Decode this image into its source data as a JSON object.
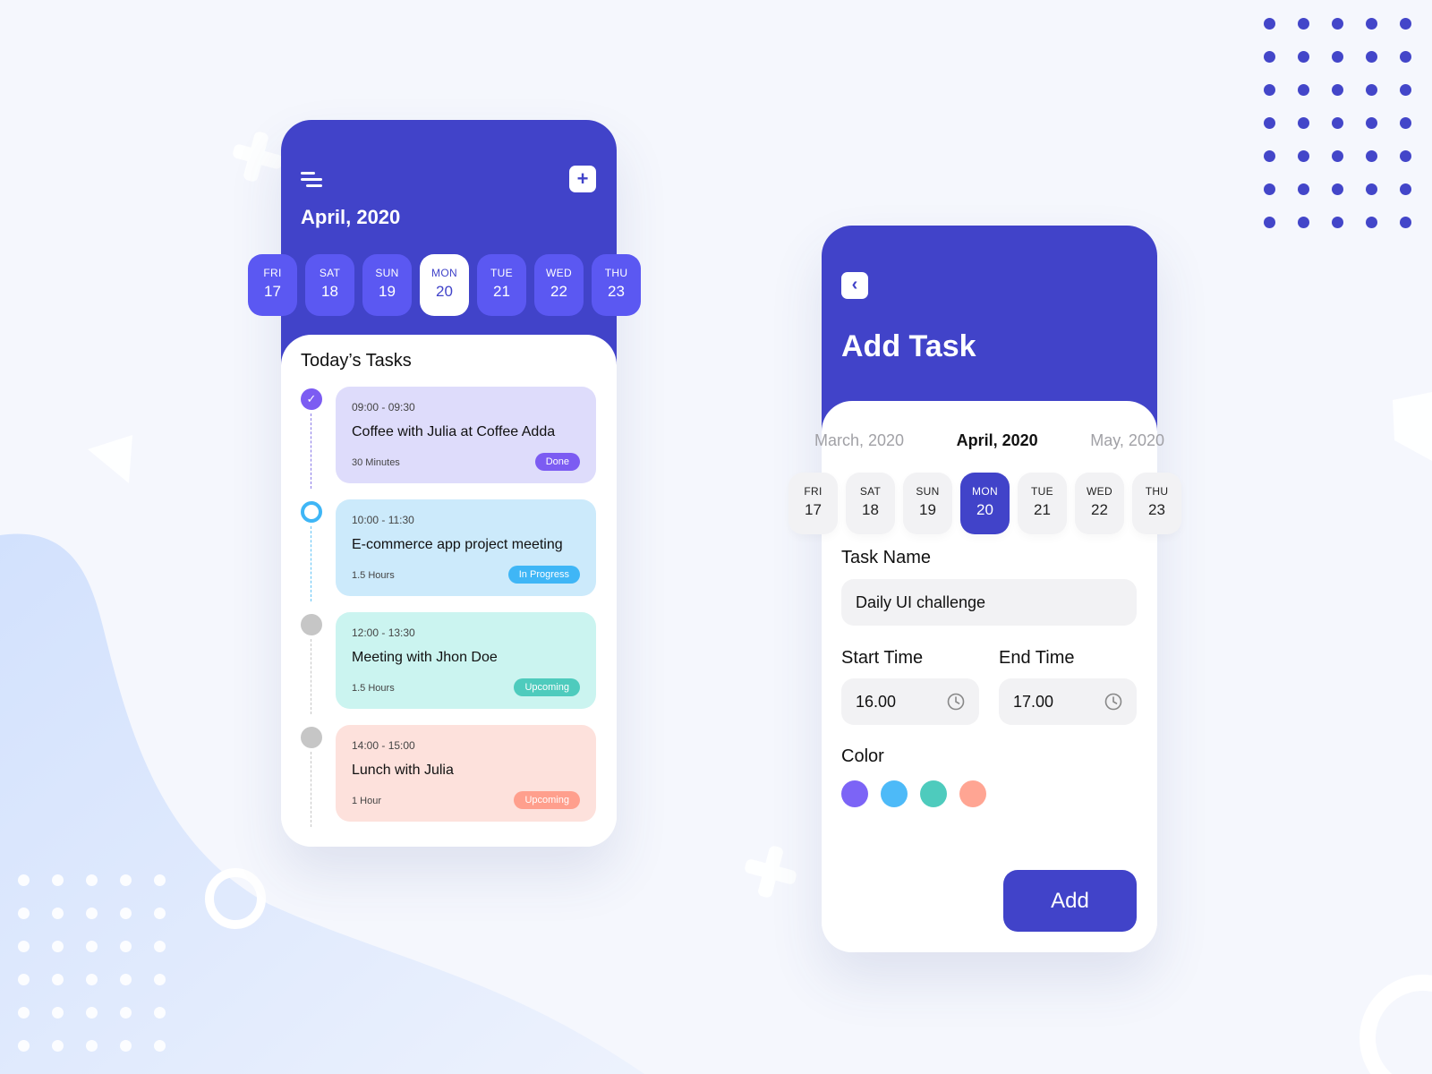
{
  "theme": {
    "primary": "#4143c9",
    "day_chip": "#5b58f2",
    "background": "#f5f7fd"
  },
  "week": [
    {
      "name": "FRI",
      "num": "17"
    },
    {
      "name": "SAT",
      "num": "18"
    },
    {
      "name": "SUN",
      "num": "19"
    },
    {
      "name": "MON",
      "num": "20",
      "active": true
    },
    {
      "name": "TUE",
      "num": "21"
    },
    {
      "name": "WED",
      "num": "22"
    },
    {
      "name": "THU",
      "num": "23"
    }
  ],
  "left_screen": {
    "menu_icon": "menu-icon",
    "add_icon": "plus-icon",
    "month_title": "April, 2020",
    "section_title": "Today’s Tasks",
    "tasks": [
      {
        "time": "09:00 - 09:30",
        "title": "Coffee with Julia at Coffee Adda",
        "duration": "30 Minutes",
        "status": "Done",
        "card_color": "#dedcfb",
        "badge_color": "#7c5cf2",
        "marker": "done"
      },
      {
        "time": "10:00 - 11:30",
        "title": "E-commerce app project meeting",
        "duration": "1.5 Hours",
        "status": "In Progress",
        "card_color": "#cceafb",
        "badge_color": "#3fb6f6",
        "marker": "progress"
      },
      {
        "time": "12:00 - 13:30",
        "title": "Meeting with Jhon Doe",
        "duration": "1.5 Hours",
        "status": "Upcoming",
        "card_color": "#cbf4f0",
        "badge_color": "#4ecbbd",
        "marker": "upcoming"
      },
      {
        "time": "14:00 - 15:00",
        "title": "Lunch with Julia",
        "duration": "1 Hour",
        "status": "Upcoming",
        "card_color": "#fde1dc",
        "badge_color": "#ff9f8d",
        "marker": "upcoming"
      }
    ]
  },
  "right_screen": {
    "back_icon": "chevron-left-icon",
    "title": "Add Task",
    "prev_month": "March, 2020",
    "current_month": "April, 2020",
    "next_month": "May, 2020",
    "task_name_label": "Task Name",
    "task_name_value": "Daily UI challenge",
    "start_time_label": "Start Time",
    "start_time_value": "16.00",
    "end_time_label": "End Time",
    "end_time_value": "17.00",
    "clock_icon": "clock-icon",
    "color_label": "Color",
    "colors": [
      "#7c64f6",
      "#4dbaf8",
      "#4ecbbd",
      "#ffa593"
    ],
    "add_button": "Add"
  }
}
